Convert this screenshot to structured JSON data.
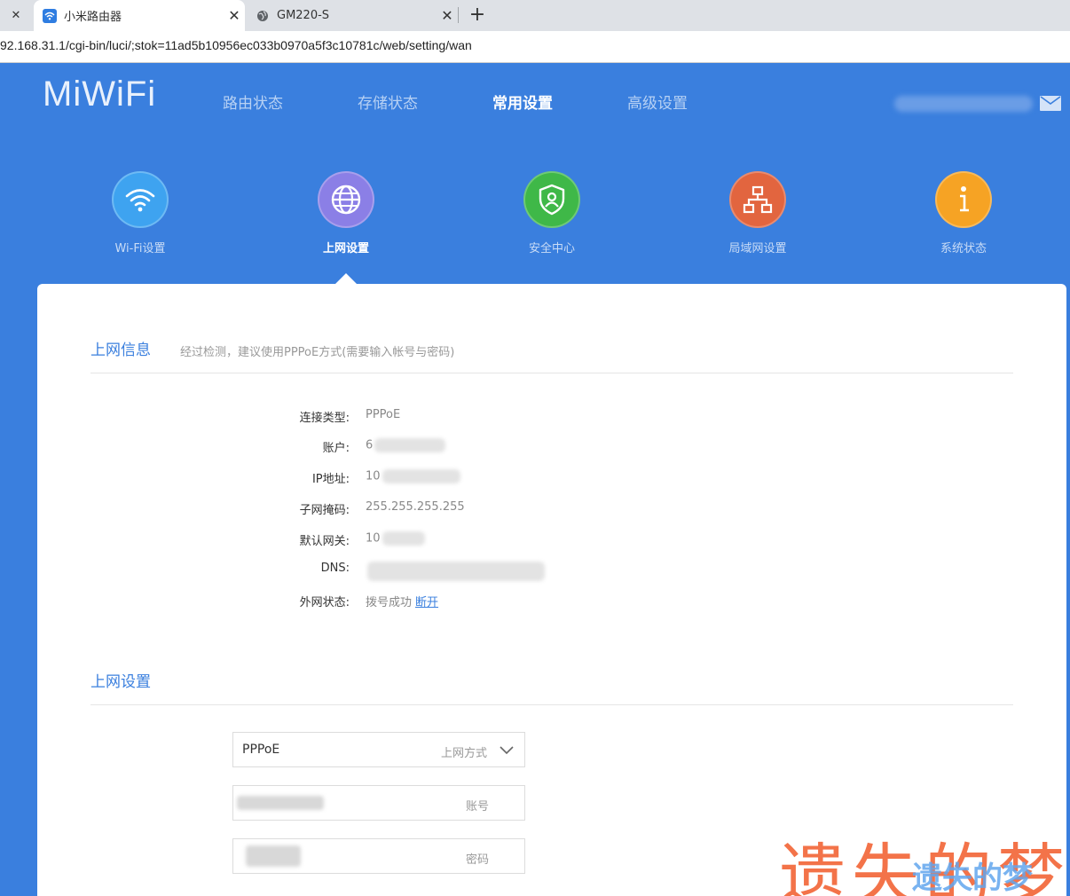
{
  "browser": {
    "tabs": [
      {
        "title": "小米路由器",
        "active": true
      },
      {
        "title": "GM220-S",
        "active": false
      }
    ],
    "url": "92.168.31.1/cgi-bin/luci/;stok=11ad5b10956ec033b0970a5f3c10781c/web/setting/wan"
  },
  "header": {
    "logo": "MiWiFi",
    "nav": [
      "路由状态",
      "存储状态",
      "常用设置",
      "高级设置"
    ],
    "current_nav": "常用设置"
  },
  "features": [
    {
      "label": "Wi-Fi设置",
      "icon": "wifi-icon",
      "color": "#3ea3f0"
    },
    {
      "label": "上网设置",
      "icon": "globe-icon",
      "color": "#8b7fe6"
    },
    {
      "label": "安全中心",
      "icon": "shield-user-icon",
      "color": "#3fb848"
    },
    {
      "label": "局域网设置",
      "icon": "network-icon",
      "color": "#e2653f"
    },
    {
      "label": "系统状态",
      "icon": "info-icon",
      "color": "#f6a324"
    }
  ],
  "active_feature": "上网设置",
  "wan_info": {
    "title": "上网信息",
    "hint": "经过检测，建议使用PPPoE方式(需要输入帐号与密码)",
    "rows": [
      {
        "key": "连接类型:",
        "value": "PPPoE"
      },
      {
        "key": "账户:",
        "value": "6"
      },
      {
        "key": "IP地址:",
        "value": "10"
      },
      {
        "key": "子网掩码:",
        "value": "255.255.255.255"
      },
      {
        "key": "默认网关:",
        "value": "10"
      },
      {
        "key": "DNS:",
        "value": ""
      },
      {
        "key": "外网状态:",
        "value": "拨号成功",
        "link": "断开"
      }
    ]
  },
  "wan_settings": {
    "title": "上网设置",
    "mode_value": "PPPoE",
    "mode_label": "上网方式",
    "account_label": "账号",
    "password_label": "密码"
  },
  "watermark": {
    "main": "遗失的梦",
    "overlay": "遗失的梦"
  },
  "colors": {
    "brand_blue": "#3a7fde",
    "watermark_orange": "#f2683a"
  }
}
